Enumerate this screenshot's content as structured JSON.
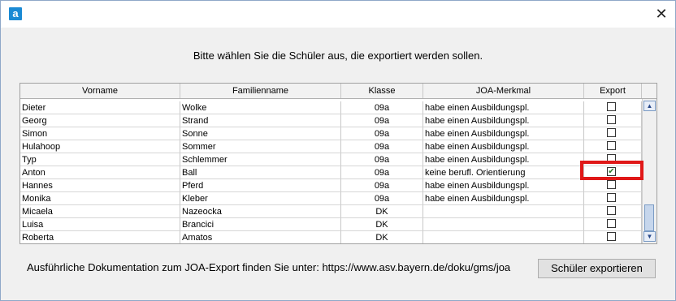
{
  "window": {
    "app_icon_letter": "a",
    "close_symbol": "✕"
  },
  "instruction": "Bitte wählen Sie die Schüler aus, die exportiert werden sollen.",
  "table": {
    "columns": [
      "Vorname",
      "Familienname",
      "Klasse",
      "JOA-Merkmal",
      "Export"
    ],
    "rows": [
      {
        "vorname": "Dieter",
        "familienname": "Wolke",
        "klasse": "09a",
        "merkmal": "habe einen Ausbildungspl.",
        "export": false
      },
      {
        "vorname": "Georg",
        "familienname": "Strand",
        "klasse": "09a",
        "merkmal": "habe einen Ausbildungspl.",
        "export": false
      },
      {
        "vorname": "Simon",
        "familienname": "Sonne",
        "klasse": "09a",
        "merkmal": "habe einen Ausbildungspl.",
        "export": false
      },
      {
        "vorname": "Hulahoop",
        "familienname": "Sommer",
        "klasse": "09a",
        "merkmal": "habe einen Ausbildungspl.",
        "export": false
      },
      {
        "vorname": "Typ",
        "familienname": "Schlemmer",
        "klasse": "09a",
        "merkmal": "habe einen Ausbildungspl.",
        "export": false
      },
      {
        "vorname": "Anton",
        "familienname": "Ball",
        "klasse": "09a",
        "merkmal": "keine berufl. Orientierung",
        "export": true
      },
      {
        "vorname": "Hannes",
        "familienname": "Pferd",
        "klasse": "09a",
        "merkmal": "habe einen Ausbildungspl.",
        "export": false
      },
      {
        "vorname": "Monika",
        "familienname": "Kleber",
        "klasse": "09a",
        "merkmal": "habe einen Ausbildungspl.",
        "export": false
      },
      {
        "vorname": "Micaela",
        "familienname": "Nazeocka",
        "klasse": "DK",
        "merkmal": "",
        "export": false
      },
      {
        "vorname": "Luisa",
        "familienname": "Brancici",
        "klasse": "DK",
        "merkmal": "",
        "export": false
      },
      {
        "vorname": "Roberta",
        "familienname": "Amatos",
        "klasse": "DK",
        "merkmal": "",
        "export": false
      }
    ]
  },
  "footer": {
    "doc_text": "Ausführliche Dokumentation zum JOA-Export finden Sie unter: https://www.asv.bayern.de/doku/gms/joa",
    "export_button": "Schüler exportieren"
  },
  "colors": {
    "highlight": "#e01818",
    "checkmark": "#2a7a2a"
  },
  "icons": {
    "scroll_up": "chevron-up-icon",
    "scroll_down": "chevron-down-icon"
  }
}
